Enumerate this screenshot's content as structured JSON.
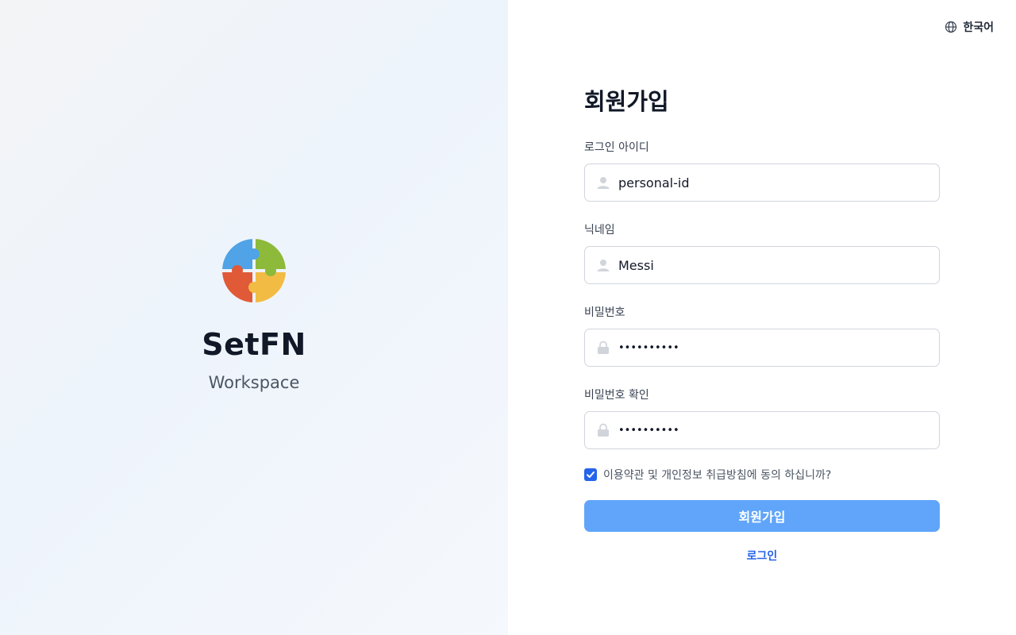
{
  "brand": {
    "name": "SetFN",
    "subtitle": "Workspace",
    "logo_colors": {
      "blue": "#4fa3e6",
      "green": "#8dba3a",
      "red": "#e05a37",
      "yellow": "#f2bb43"
    }
  },
  "language": {
    "label": "한국어",
    "icon": "globe-icon"
  },
  "form": {
    "title": "회원가입",
    "login_id": {
      "label": "로그인 아이디",
      "value": "personal-id",
      "icon": "user-icon"
    },
    "nickname": {
      "label": "닉네임",
      "value": "Messi",
      "icon": "user-icon"
    },
    "password": {
      "label": "비밀번호",
      "value": "••••••••••",
      "icon": "lock-icon"
    },
    "password_confirm": {
      "label": "비밀번호 확인",
      "value": "••••••••••",
      "icon": "lock-icon"
    },
    "agree": {
      "label": "이용약관 및 개인정보 취급방침에 동의 하십니까?",
      "checked": true
    },
    "submit_label": "회원가입",
    "login_link": "로그인"
  },
  "colors": {
    "accent": "#60a5fa",
    "link": "#2563eb",
    "checkbox": "#2563eb"
  }
}
